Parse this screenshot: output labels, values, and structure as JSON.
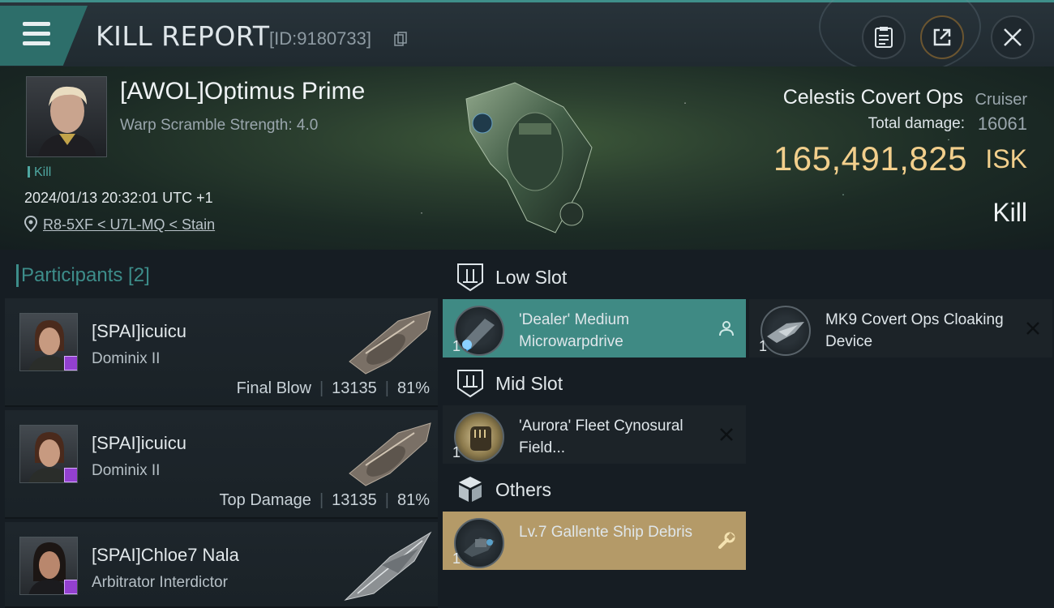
{
  "header": {
    "title": "KILL REPORT",
    "report_id": "[ID:9180733]",
    "icons": [
      "menu-icon",
      "copy-icon",
      "clipboard-icon",
      "share-icon",
      "close-icon"
    ]
  },
  "victim": {
    "name": "[AWOL]Optimus Prime",
    "warp_scramble": "Warp Scramble Strength: 4.0",
    "tag": "Kill",
    "timestamp": "2024/01/13 20:32:01 UTC +1",
    "location": "R8-5XF < U7L-MQ < Stain"
  },
  "ship": {
    "name": "Celestis Covert Ops",
    "class": "Cruiser",
    "total_damage_label": "Total damage:",
    "total_damage": "16061",
    "isk_value": "165,491,825",
    "isk_unit": "ISK",
    "result": "Kill"
  },
  "participants": {
    "header": "Participants [2]",
    "items": [
      {
        "name": "[SPAI]icuicu",
        "ship": "Dominix II",
        "role": "Final Blow",
        "damage": "13135",
        "percent": "81%"
      },
      {
        "name": "[SPAI]icuicu",
        "ship": "Dominix II",
        "role": "Top Damage",
        "damage": "13135",
        "percent": "81%"
      },
      {
        "name": "[SPAI]Chloe7 Nala",
        "ship": "Arbitrator Interdictor",
        "role": "",
        "damage": "",
        "percent": ""
      }
    ]
  },
  "fitting": {
    "low_slot": {
      "label": "Low Slot",
      "modules": [
        {
          "qty": "1",
          "name": "'Dealer' Medium Microwarpdrive",
          "status": "dropped",
          "status_icon": "person-icon"
        },
        {
          "qty": "1",
          "name": "MK9 Covert Ops Cloaking Device",
          "status": "destroyed",
          "status_icon": "close-icon"
        }
      ]
    },
    "mid_slot": {
      "label": "Mid Slot",
      "modules": [
        {
          "qty": "1",
          "name": "'Aurora' Fleet Cynosural Field...",
          "status": "destroyed",
          "status_icon": "close-icon"
        }
      ]
    },
    "others": {
      "label": "Others",
      "modules": [
        {
          "qty": "1",
          "name": "Lv.7 Gallente Ship Debris",
          "status": "salvage",
          "status_icon": "wrench-icon"
        }
      ]
    }
  },
  "colors": {
    "accent_teal": "#3d8d8a",
    "isk_gold": "#f2cf8c",
    "dropped_bg": "#3f8a84",
    "salvage_bg": "#b49a68",
    "destroyed_bg": "#1c2328",
    "badge_purple": "#9340d0"
  }
}
